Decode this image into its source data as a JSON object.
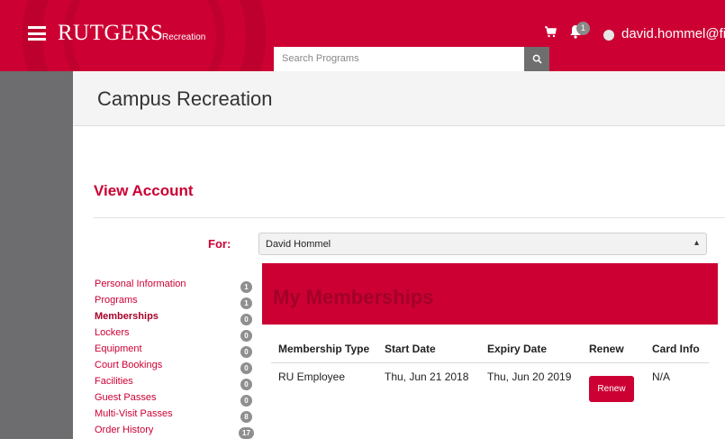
{
  "topbar": {
    "brand": "RUTGERS",
    "brand_sub": "Recreation",
    "search_placeholder": "Search Programs",
    "notification_count": "1",
    "user_name": "david.hommel@fi"
  },
  "header": {
    "title": "Campus Recreation"
  },
  "account": {
    "heading": "View Account",
    "for_label": "For:",
    "selected_person": "David Hommel"
  },
  "sidenav": {
    "items": [
      {
        "label": "Personal Information",
        "badge": "1"
      },
      {
        "label": "Programs",
        "badge": "1"
      },
      {
        "label": "Memberships",
        "badge": "0"
      },
      {
        "label": "Lockers",
        "badge": "0"
      },
      {
        "label": "Equipment",
        "badge": "0"
      },
      {
        "label": "Court Bookings",
        "badge": "0"
      },
      {
        "label": "Facilities",
        "badge": "0"
      },
      {
        "label": "Guest Passes",
        "badge": "0"
      },
      {
        "label": "Multi-Visit Passes",
        "badge": "8"
      },
      {
        "label": "Order History",
        "badge": "17"
      }
    ]
  },
  "memberships": {
    "title": "My Memberships",
    "columns": [
      "Membership Type",
      "Start Date",
      "Expiry Date",
      "Renew",
      "Card Info"
    ],
    "rows": [
      {
        "type": "RU Employee",
        "start": "Thu, Jun 21 2018",
        "expiry": "Thu, Jun 20 2019",
        "renew_label": "Renew",
        "card_info": "N/A"
      }
    ]
  },
  "colors": {
    "accent": "#cc0033",
    "rail": "#6d6d6f"
  },
  "icons": {
    "menu": "hamburger-icon",
    "cart": "cart-icon",
    "bell": "bell-icon",
    "search": "search-icon"
  }
}
